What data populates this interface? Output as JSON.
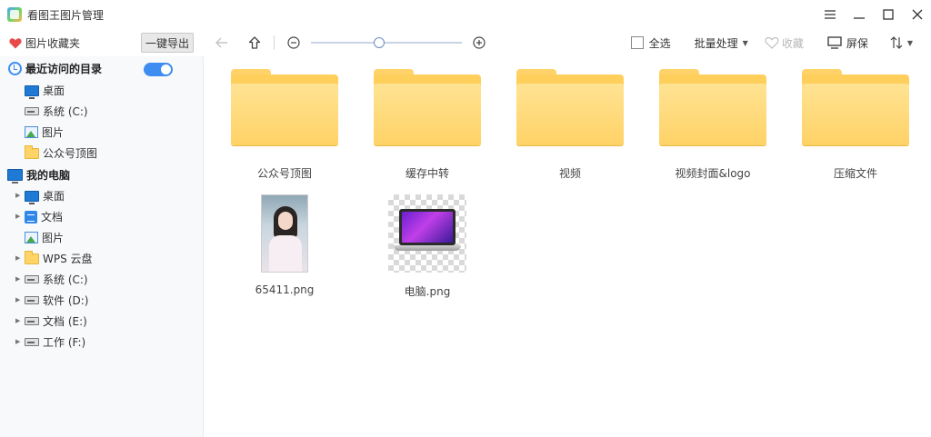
{
  "app": {
    "title": "看图王图片管理"
  },
  "window": {
    "menu_icon": "menu-icon",
    "minimize_icon": "minimize-icon",
    "maximize_icon": "maximize-icon",
    "close_icon": "close-icon"
  },
  "toolbar": {
    "favorites_label": "图片收藏夹",
    "export_label": "一键导出",
    "zoom_level": 0.45,
    "select_all_label": "全选",
    "batch_label": "批量处理",
    "favorite_label": "收藏",
    "screen_label": "屏保",
    "sort_icon": "sort-icon"
  },
  "sidebar": {
    "recent": {
      "title": "最近访问的目录",
      "toggle_on": true,
      "items": [
        {
          "label": "桌面",
          "icon": "monitor-icon"
        },
        {
          "label": "系统 (C:)",
          "icon": "drive-icon"
        },
        {
          "label": "图片",
          "icon": "image-icon"
        },
        {
          "label": "公众号顶图",
          "icon": "folder-icon"
        }
      ]
    },
    "computer": {
      "title": "我的电脑",
      "items": [
        {
          "label": "桌面",
          "icon": "monitor-icon",
          "expandable": true
        },
        {
          "label": "文档",
          "icon": "document-icon",
          "expandable": true
        },
        {
          "label": "图片",
          "icon": "image-icon",
          "expandable": false
        },
        {
          "label": "WPS 云盘",
          "icon": "folder-icon",
          "expandable": true
        },
        {
          "label": "系统 (C:)",
          "icon": "drive-icon",
          "expandable": true
        },
        {
          "label": "软件 (D:)",
          "icon": "drive-icon",
          "expandable": true
        },
        {
          "label": "文档 (E:)",
          "icon": "drive-icon",
          "expandable": true
        },
        {
          "label": "工作 (F:)",
          "icon": "drive-icon",
          "expandable": true
        }
      ]
    }
  },
  "content": {
    "folders": [
      {
        "name": "公众号顶图"
      },
      {
        "name": "缓存中转"
      },
      {
        "name": "视频"
      },
      {
        "name": "视频封面&logo"
      },
      {
        "name": "压缩文件"
      }
    ],
    "files": [
      {
        "name": "65411.png"
      },
      {
        "name": "电脑.png"
      }
    ]
  },
  "colors": {
    "accent": "#3e8df0",
    "folder": "#ffd266",
    "sidebar_bg": "#f7f9fb"
  }
}
